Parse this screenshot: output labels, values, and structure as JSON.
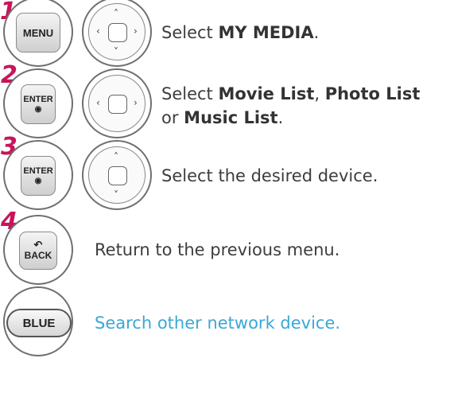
{
  "steps": [
    {
      "number": "1",
      "button": "MENU",
      "nav": "4-way",
      "text": [
        "Select ",
        "MY MEDIA",
        "."
      ]
    },
    {
      "number": "2",
      "button": "ENTER",
      "nav": "left-right",
      "text": [
        "Select ",
        "Movie List",
        ", ",
        "Photo List",
        " or ",
        "Music List",
        "."
      ]
    },
    {
      "number": "3",
      "button": "ENTER",
      "nav": "up-down",
      "text": [
        "Select the desired device."
      ]
    },
    {
      "number": "4",
      "button": "BACK",
      "text": [
        "Return to the previous menu."
      ]
    }
  ],
  "extra": {
    "button": "BLUE",
    "text": "Search other network device."
  },
  "colors": {
    "step_number": "#c8145a",
    "blue_text": "#3ba7d6",
    "body_text": "#3d3d3d"
  },
  "icons": {
    "enter_dot": "◉",
    "back_arrow": "↶",
    "up": "˄",
    "down": "˅",
    "left": "‹",
    "right": "›"
  }
}
